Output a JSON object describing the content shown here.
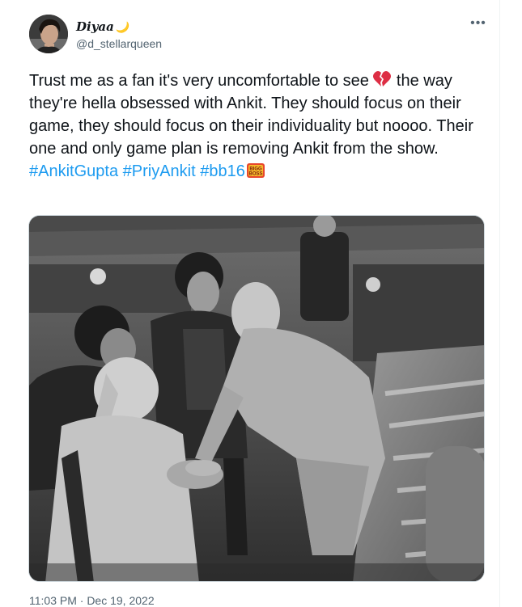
{
  "tweet": {
    "display_name": "Diyaa",
    "name_emoji": "🌙",
    "handle": "@d_stellarqueen",
    "more_label": "•••",
    "text_part1": "Trust me as a fan it's very uncomfortable to see",
    "heart_emoji": "💔",
    "text_part2": "the way they're hella obsessed with Ankit. They should focus on their game, they should focus on their individuality but noooo. Their one and only game plan is removing Ankit from the show.",
    "hashtags": [
      "#AnkitGupta",
      "#PriyAnkit",
      "#bb16"
    ],
    "badge_text": [
      "BIGG",
      "BOSS"
    ],
    "timestamp": "11:03 PM · Dec 19, 2022"
  },
  "colors": {
    "text": "#0f1419",
    "secondary": "#536471",
    "link": "#1d9bf0"
  },
  "icons": {
    "more": "more-horizontal-icon",
    "heart": "broken-heart-emoji",
    "moon": "crescent-moon-emoji",
    "badge": "bigg-boss-logo"
  }
}
